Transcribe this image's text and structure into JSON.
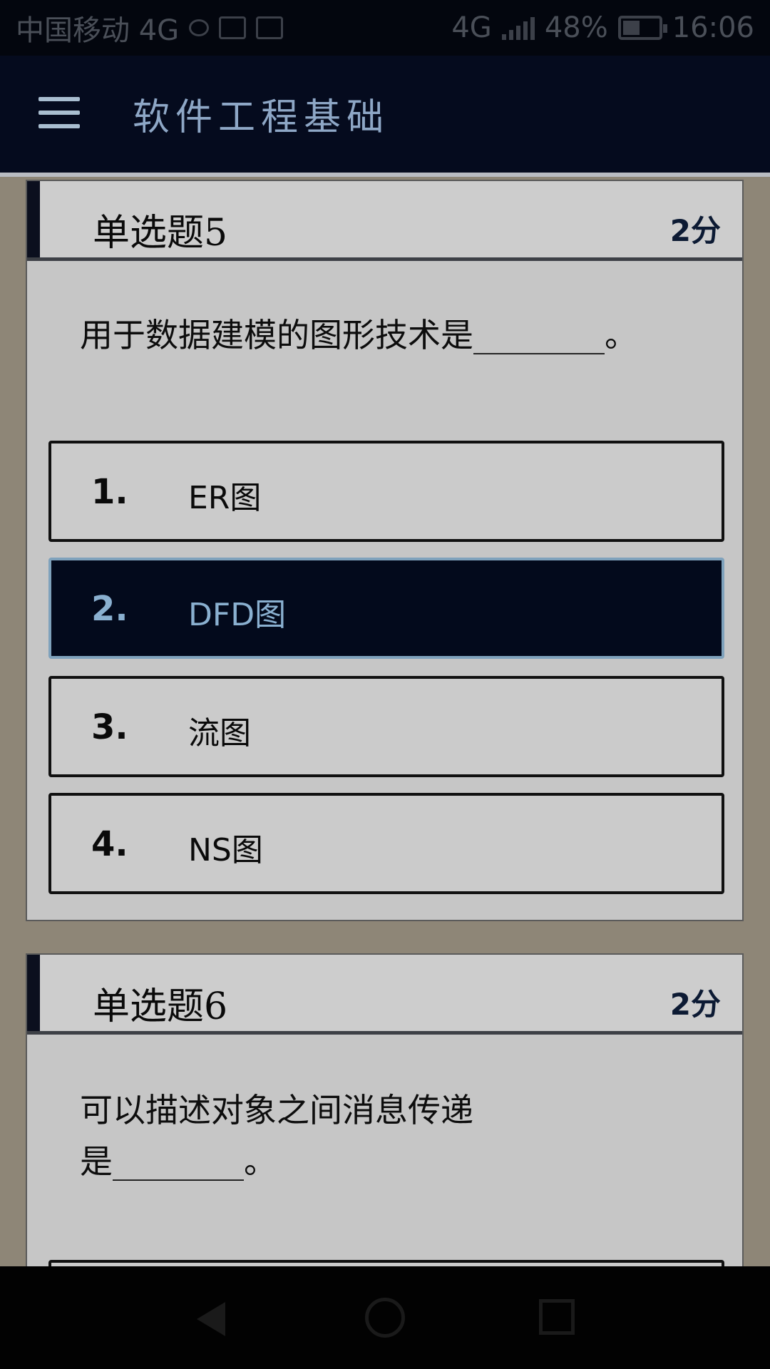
{
  "status_bar": {
    "carrier": "中国移动 4G",
    "network_label": "4G",
    "battery_percent": "48%",
    "battery_level": 0.48,
    "time": "16:06",
    "icons": [
      "chat-bubble-icon",
      "app-icon",
      "image-icon",
      "signal-icon",
      "battery-icon"
    ]
  },
  "app_bar": {
    "title": "软件工程基础",
    "menu_icon": "hamburger-menu-icon"
  },
  "questions": [
    {
      "title": "单选题5",
      "score": "2分",
      "text": "用于数据建模的图形技术是________。",
      "options": [
        {
          "number": "1.",
          "label": "ER图",
          "selected": false
        },
        {
          "number": "2.",
          "label": "DFD图",
          "selected": true
        },
        {
          "number": "3.",
          "label": "流图",
          "selected": false
        },
        {
          "number": "4.",
          "label": "NS图",
          "selected": false
        }
      ]
    },
    {
      "title": "单选题6",
      "score": "2分",
      "text_line1": "可以描述对象之间消息传递",
      "text_line2": "是________。"
    }
  ],
  "nav_bar": {
    "icons": [
      "back-icon",
      "home-icon",
      "recent-apps-icon"
    ]
  },
  "colors": {
    "app_bar": "#050b1e",
    "selected_option": "#030a1c",
    "selected_text": "#8ab0d0",
    "page_background": "#8e8677"
  }
}
